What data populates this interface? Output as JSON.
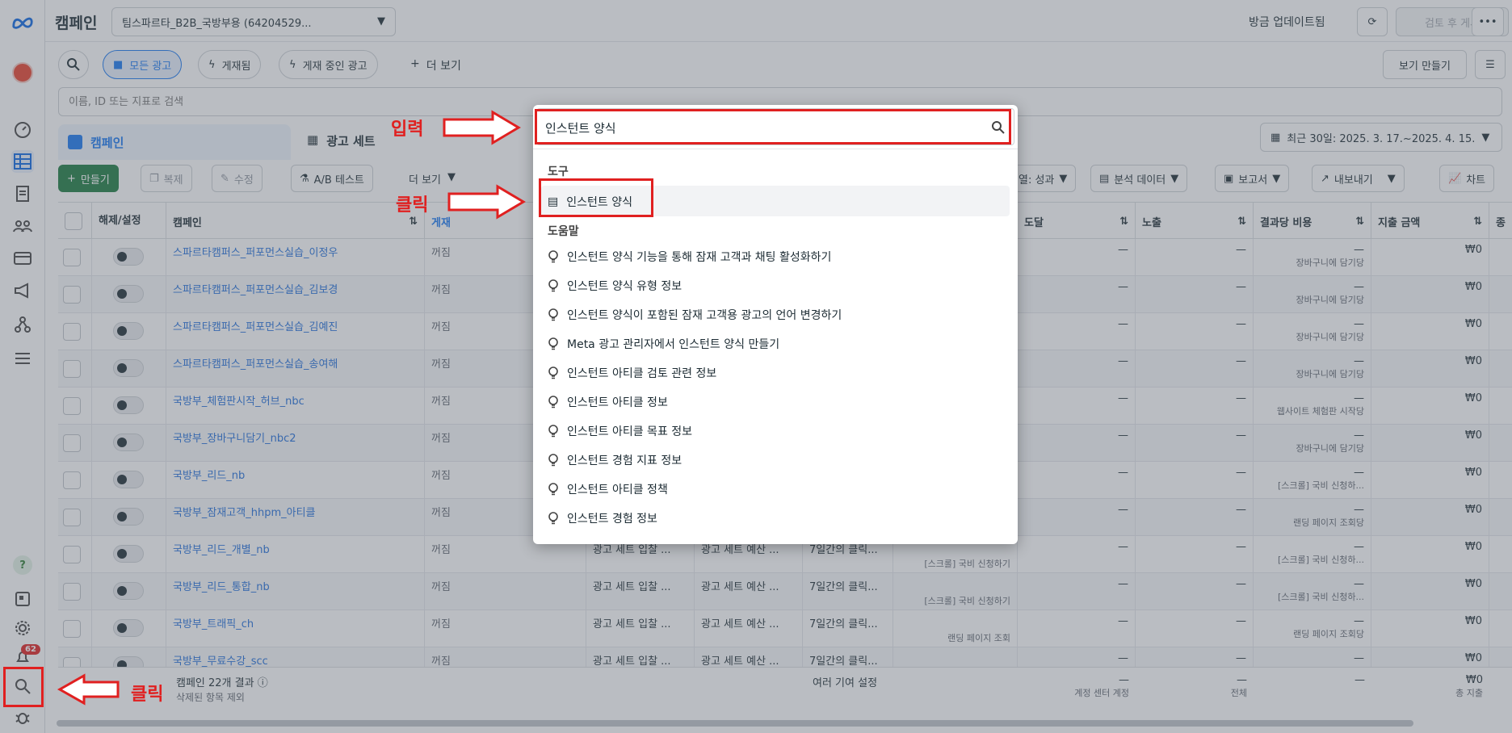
{
  "header": {
    "title": "캠페인",
    "account_selector": "팀스파르타_B2B_국방부용 (64204529...",
    "update_status": "방금 업데이트됨",
    "review_publish": "검토 후 게시"
  },
  "filters": {
    "all_ads": "모든 광고",
    "published": "게재됨",
    "active_ads": "게재 중인 광고",
    "more": "더 보기",
    "create_view": "보기 만들기",
    "search_placeholder": "이름, ID 또는 지표로 검색"
  },
  "tabs": {
    "campaign": "캠페인",
    "adset": "광고 세트",
    "date_range": "최근 30일: 2025. 3. 17.~2025. 4. 15."
  },
  "toolbar": {
    "create": "만들기",
    "duplicate": "복제",
    "edit": "수정",
    "ab_test": "A/B 테스트",
    "more": "더 보기",
    "columns": "열: 성과",
    "breakdown": "분석 데이터",
    "reports": "보고서",
    "export": "내보내기",
    "chart": "차트"
  },
  "columns": {
    "toggle": "해제/설정",
    "campaign": "캠페인",
    "delivery": "게재",
    "reach": "도달",
    "impressions": "노출",
    "cost_per_result": "결과당 비용",
    "amount_spent": "지출 금액",
    "last": "종"
  },
  "rows": [
    {
      "name": "스파르타캠퍼스_퍼포먼스실습_이정우",
      "status": "꺼짐",
      "bid": "",
      "budget": "",
      "attr": "",
      "result": "",
      "reach": "—",
      "impr": "—",
      "cpr": "—",
      "cpr_sub": "장바구니에 담기당",
      "spent": "₩0"
    },
    {
      "name": "스파르타캠퍼스_퍼포먼스실습_김보경",
      "status": "꺼짐",
      "bid": "",
      "budget": "",
      "attr": "",
      "result": "",
      "reach": "—",
      "impr": "—",
      "cpr": "—",
      "cpr_sub": "장바구니에 담기당",
      "spent": "₩0"
    },
    {
      "name": "스파르타캠퍼스_퍼포먼스실습_김예진",
      "status": "꺼짐",
      "bid": "",
      "budget": "",
      "attr": "",
      "result": "",
      "reach": "—",
      "impr": "—",
      "cpr": "—",
      "cpr_sub": "장바구니에 담기당",
      "spent": "₩0"
    },
    {
      "name": "스파르타캠퍼스_퍼포먼스실습_송여해",
      "status": "꺼짐",
      "bid": "",
      "budget": "",
      "attr": "",
      "result": "",
      "reach": "—",
      "impr": "—",
      "cpr": "—",
      "cpr_sub": "장바구니에 담기당",
      "spent": "₩0"
    },
    {
      "name": "국방부_체험판시작_허브_nbc",
      "status": "꺼짐",
      "bid": "",
      "budget": "",
      "attr": "",
      "result": "",
      "reach": "—",
      "impr": "—",
      "cpr": "—",
      "cpr_sub": "웹사이트 체험판 시작당",
      "spent": "₩0"
    },
    {
      "name": "국방부_장바구니담기_nbc2",
      "status": "꺼짐",
      "bid": "",
      "budget": "",
      "attr": "",
      "result": "",
      "reach": "—",
      "impr": "—",
      "cpr": "—",
      "cpr_sub": "장바구니에 담기당",
      "spent": "₩0"
    },
    {
      "name": "국방부_리드_nb",
      "status": "꺼짐",
      "bid": "",
      "budget": "",
      "attr": "",
      "result": "",
      "reach": "—",
      "impr": "—",
      "cpr": "—",
      "cpr_sub": "[스크롤] 국비 신청하...",
      "spent": "₩0"
    },
    {
      "name": "국방부_잠재고객_hhpm_아티클",
      "status": "꺼짐",
      "bid": "",
      "budget": "",
      "attr": "",
      "result": "",
      "reach": "—",
      "impr": "—",
      "cpr": "—",
      "cpr_sub": "랜딩 페이지 조회당",
      "spent": "₩0"
    },
    {
      "name": "국방부_리드_개별_nb",
      "status": "꺼짐",
      "bid": "광고 세트 입찰 ...",
      "budget": "광고 세트 예산 ...",
      "attr": "7일간의 클릭...",
      "result": "[스크롤] 국비 신청하기",
      "reach": "—",
      "impr": "—",
      "cpr": "—",
      "cpr_sub": "[스크롤] 국비 신청하...",
      "spent": "₩0"
    },
    {
      "name": "국방부_리드_통합_nb",
      "status": "꺼짐",
      "bid": "광고 세트 입찰 ...",
      "budget": "광고 세트 예산 ...",
      "attr": "7일간의 클릭...",
      "result": "[스크롤] 국비 신청하기",
      "reach": "—",
      "impr": "—",
      "cpr": "—",
      "cpr_sub": "[스크롤] 국비 신청하...",
      "spent": "₩0"
    },
    {
      "name": "국방부_트래픽_ch",
      "status": "꺼짐",
      "bid": "광고 세트 입찰 ...",
      "budget": "광고 세트 예산 ...",
      "attr": "7일간의 클릭...",
      "result": "랜딩 페이지 조회",
      "reach": "—",
      "impr": "—",
      "cpr": "—",
      "cpr_sub": "랜딩 페이지 조회당",
      "spent": "₩0"
    },
    {
      "name": "국방부_무료수강_scc",
      "status": "꺼짐",
      "bid": "광고 세트 입찰 ...",
      "budget": "광고 세트 예산 ...",
      "attr": "7일간의 클릭...",
      "result": "—",
      "reach": "—",
      "impr": "—",
      "cpr": "—",
      "cpr_sub": "",
      "spent": "₩0"
    }
  ],
  "footer": {
    "count": "캠페인 22개 결과",
    "excluded": "삭제된 항목 제외",
    "attribution": "여러 기여 설정",
    "reach_sub": "계정 센터 계정",
    "impr_sub": "전체",
    "spent": "₩0",
    "spent_sub": "총 지출",
    "dash": "—"
  },
  "rail": {
    "badge": "62",
    "help": "?"
  },
  "search_popup": {
    "query": "인스턴트 양식",
    "tools_heading": "도구",
    "tool_item": "인스턴트 양식",
    "help_heading": "도움말",
    "help_items": [
      "인스턴트 양식 기능을 통해 잠재 고객과 채팅 활성화하기",
      "인스턴트 양식 유형 정보",
      "인스턴트 양식이 포함된 잠재 고객용 광고의 언어 변경하기",
      "Meta 광고 관리자에서 인스턴트 양식 만들기",
      "인스턴트 아티클 검토 관련 정보",
      "인스턴트 아티클 정보",
      "인스턴트 아티클 목표 정보",
      "인스턴트 경험 지표 정보",
      "인스턴트 아티클 정책",
      "인스턴트 경험 정보"
    ]
  },
  "annotations": {
    "input": "입력",
    "click1": "클릭",
    "click2": "클릭"
  },
  "colors": {
    "accent": "#1877f2",
    "red_annotation": "#e02020",
    "create_button": "#1b7a3e"
  }
}
